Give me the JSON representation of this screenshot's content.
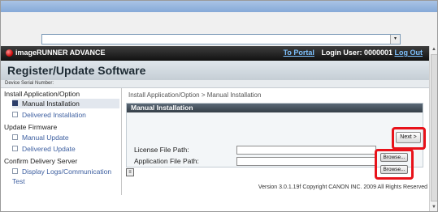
{
  "browser": {
    "address_value": "",
    "dropdown_glyph": "▾"
  },
  "header": {
    "product": "imageRUNNER ADVANCE",
    "portal_link": "To Portal",
    "login_text": "Login User: 0000001",
    "logout_link": "Log Out"
  },
  "page": {
    "title": "Register/Update Software",
    "serial_label": "Device Serial Number:"
  },
  "sidebar": {
    "cat_install": "Install Application/Option",
    "item_manual_install": "Manual Installation",
    "item_delivered_install": "Delivered Installation",
    "cat_update": "Update Firmware",
    "item_manual_update": "Manual Update",
    "item_delivered_update": "Delivered Update",
    "cat_confirm": "Confirm Delivery Server",
    "item_display_logs": "Display Logs/Communication Test"
  },
  "content": {
    "breadcrumb": "Install Application/Option > Manual Installation",
    "section_title": "Manual Installation",
    "next_label": "Next >",
    "license_label": "License File Path:",
    "application_label": "Application File Path:",
    "browse_label": "Browse...",
    "license_value": "",
    "application_value": "",
    "collapse_glyph": "≡"
  },
  "footer": {
    "version": "Version 3.0.1.19f Copyright CANON INC. 2009 All Rights Reserved"
  },
  "colors": {
    "highlight": "#e8121a",
    "header_bg": "#1a1a1a",
    "link_blue": "#7ec2ff"
  }
}
